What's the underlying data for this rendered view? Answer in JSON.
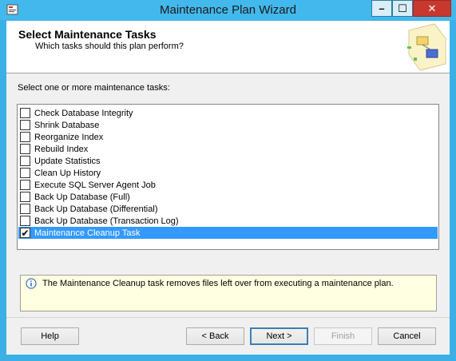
{
  "window": {
    "title": "Maintenance Plan Wizard",
    "icon": "wizard-app-icon",
    "controls": {
      "minimize": "–",
      "maximize": "☐",
      "close": "✕"
    }
  },
  "header": {
    "title": "Select Maintenance Tasks",
    "subtitle": "Which tasks should this plan perform?",
    "graphic": "wizard-graphic"
  },
  "tasks": {
    "prompt": "Select one or more maintenance tasks:",
    "items": [
      {
        "label": "Check Database Integrity",
        "checked": false,
        "selected": false
      },
      {
        "label": "Shrink Database",
        "checked": false,
        "selected": false
      },
      {
        "label": "Reorganize Index",
        "checked": false,
        "selected": false
      },
      {
        "label": "Rebuild Index",
        "checked": false,
        "selected": false
      },
      {
        "label": "Update Statistics",
        "checked": false,
        "selected": false
      },
      {
        "label": "Clean Up History",
        "checked": false,
        "selected": false
      },
      {
        "label": "Execute SQL Server Agent Job",
        "checked": false,
        "selected": false
      },
      {
        "label": "Back Up Database (Full)",
        "checked": false,
        "selected": false
      },
      {
        "label": "Back Up Database (Differential)",
        "checked": false,
        "selected": false
      },
      {
        "label": "Back Up Database (Transaction Log)",
        "checked": false,
        "selected": false
      },
      {
        "label": "Maintenance Cleanup Task",
        "checked": true,
        "selected": true
      }
    ]
  },
  "info": {
    "icon": "info-icon",
    "text": "The Maintenance Cleanup task removes files left over from executing a maintenance plan."
  },
  "buttons": {
    "help": "Help",
    "back": "< Back",
    "next": "Next >",
    "finish": "Finish",
    "cancel": "Cancel"
  },
  "colors": {
    "frame": "#43b8ec",
    "selection": "#3399ff",
    "info_background": "#ffffe1",
    "close_button": "#c7392f"
  }
}
